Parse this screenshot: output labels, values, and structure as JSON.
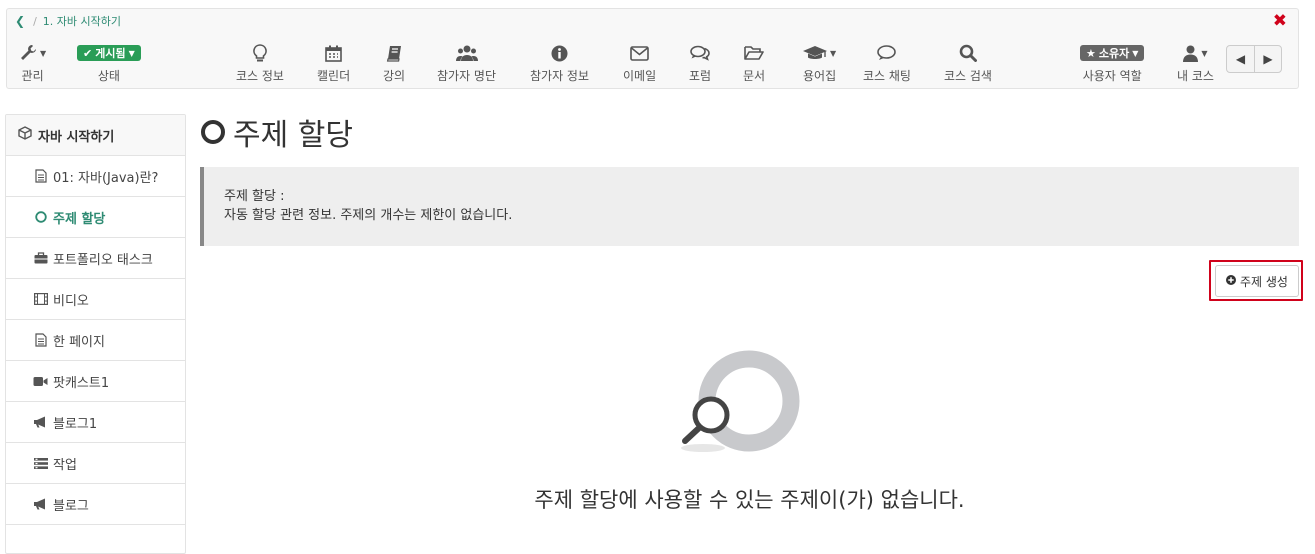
{
  "breadcrumb": {
    "sep": "/",
    "current": "1. 자바 시작하기"
  },
  "toolbar": {
    "manage": "관리",
    "status_badge": "게시됨",
    "status": "상태",
    "course_info": "코스 정보",
    "calendar": "캘린더",
    "lecture": "강의",
    "participants": "참가자 명단",
    "participant_info": "참가자 정보",
    "email": "이메일",
    "forum": "포럼",
    "documents": "문서",
    "glossary": "용어집",
    "chat": "코스 채팅",
    "search": "코스 검색",
    "role_badge": "소유자",
    "role": "사용자 역할",
    "my_courses": "내 코스"
  },
  "sidebar": {
    "title": "자바 시작하기",
    "items": [
      {
        "label": "01: 자바(Java)란?",
        "icon": "document-icon"
      },
      {
        "label": "주제 할당",
        "icon": "circle-icon",
        "active": true
      },
      {
        "label": "포트폴리오 태스크",
        "icon": "briefcase-icon"
      },
      {
        "label": "비디오",
        "icon": "film-icon"
      },
      {
        "label": "한 페이지",
        "icon": "document-icon"
      },
      {
        "label": "팟캐스트1",
        "icon": "video-camera-icon"
      },
      {
        "label": "블로그1",
        "icon": "megaphone-icon"
      },
      {
        "label": "작업",
        "icon": "task-list-icon"
      },
      {
        "label": "블로그",
        "icon": "megaphone-icon"
      }
    ]
  },
  "main": {
    "title": "주제 할당",
    "info_label": "주제 할당 :",
    "info_text": "자동 할당 관련 정보. 주제의 개수는 제한이 없습니다.",
    "create_button": "주제 생성",
    "empty_message": "주제 할당에 사용할 수 있는 주제이(가) 없습니다."
  },
  "colors": {
    "accent": "#2e8b73",
    "published": "#2a9d57",
    "close": "#d0021b",
    "highlight": "#d0021b"
  }
}
